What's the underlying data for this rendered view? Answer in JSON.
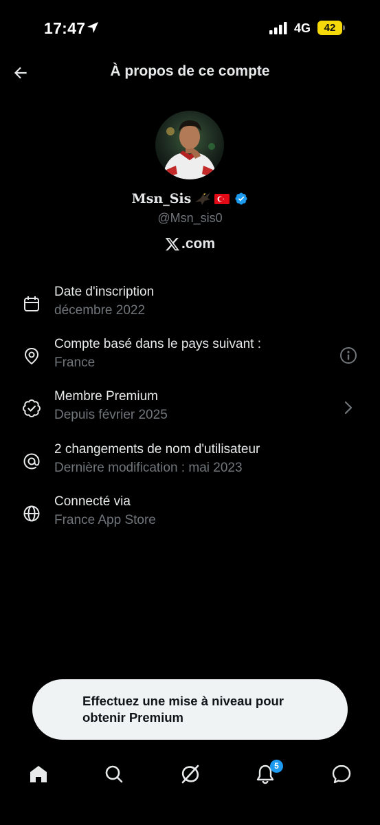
{
  "status_bar": {
    "time": "17:47",
    "network": "4G",
    "battery_level": "42",
    "battery_color": "#f5d90a"
  },
  "header": {
    "title": "À propos de ce compte",
    "back_icon": "arrow-left-icon"
  },
  "profile": {
    "display_name": "Msn_Sis",
    "name_emojis": [
      "eagle-emoji",
      "turkey-flag-emoji"
    ],
    "verified": true,
    "verified_color": "#1d9bf0",
    "handle": "@Msn_sis0",
    "domain": ".com",
    "domain_logo": "x-logo-icon"
  },
  "info_items": [
    {
      "icon": "calendar-icon",
      "title": "Date d'inscription",
      "subtitle": "décembre 2022",
      "trailing": ""
    },
    {
      "icon": "location-pin-icon",
      "title": "Compte basé dans le pays suivant :",
      "subtitle": "France",
      "trailing": "info-icon"
    },
    {
      "icon": "verified-badge-icon",
      "title": "Membre Premium",
      "subtitle": "Depuis février 2025",
      "trailing": "chevron-right-icon"
    },
    {
      "icon": "at-sign-icon",
      "title": "2 changements de nom d'utilisateur",
      "subtitle": "Dernière modification : mai 2023",
      "trailing": ""
    },
    {
      "icon": "globe-icon",
      "title": "Connecté via",
      "subtitle": "France App Store",
      "trailing": ""
    }
  ],
  "premium_banner": {
    "text": "Effectuez une mise à niveau pour obtenir Premium"
  },
  "bottom_nav": {
    "items": [
      "home-icon",
      "search-icon",
      "grok-icon",
      "notifications-icon",
      "messages-icon"
    ],
    "notification_badge": "5",
    "badge_color": "#1d9bf0"
  }
}
